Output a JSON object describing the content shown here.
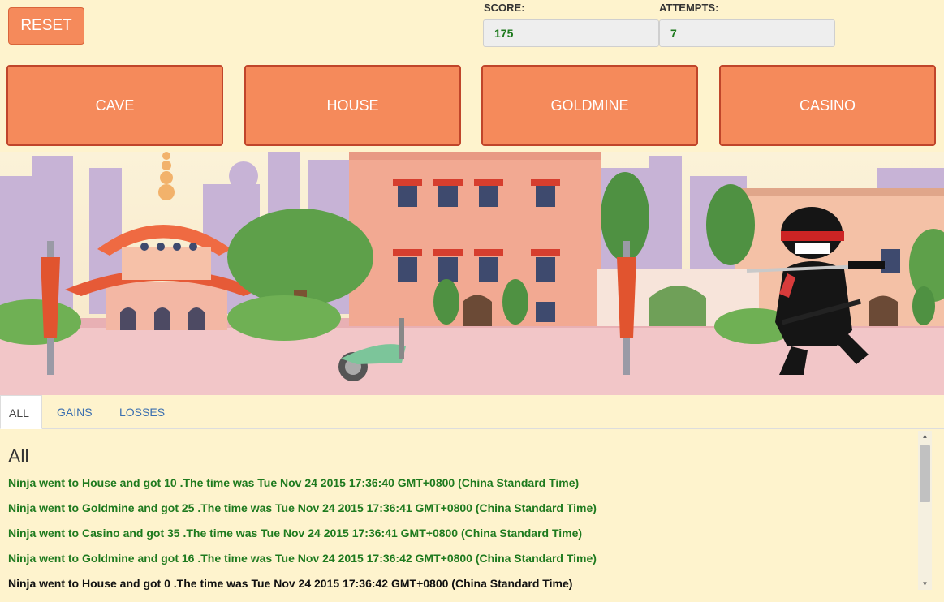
{
  "controls": {
    "reset_label": "RESET"
  },
  "stats": {
    "score_label": "SCORE:",
    "score_value": "175",
    "attempts_label": "ATTEMPTS:",
    "attempts_value": "7"
  },
  "locations": [
    "CAVE",
    "HOUSE",
    "GOLDMINE",
    "CASINO"
  ],
  "tabs": [
    "ALL",
    "GAINS",
    "LOSSES"
  ],
  "log": {
    "heading": "All",
    "entries": [
      {
        "text": "Ninja went to House and got 10 .The time was Tue Nov 24 2015 17:36:40 GMT+0800 (China Standard Time)",
        "color": "#1e7a1e"
      },
      {
        "text": "Ninja went to Goldmine and got 25 .The time was Tue Nov 24 2015 17:36:41 GMT+0800 (China Standard Time)",
        "color": "#1e7a1e"
      },
      {
        "text": "Ninja went to Casino and got 35 .The time was Tue Nov 24 2015 17:36:41 GMT+0800 (China Standard Time)",
        "color": "#1e7a1e"
      },
      {
        "text": "Ninja went to Goldmine and got 16 .The time was Tue Nov 24 2015 17:36:42 GMT+0800 (China Standard Time)",
        "color": "#1e7a1e"
      },
      {
        "text": "Ninja went to House and got 0 .The time was Tue Nov 24 2015 17:36:42 GMT+0800 (China Standard Time)",
        "color": "#111111"
      }
    ]
  },
  "colors": {
    "accent": "#f58a5b",
    "background": "#fef3cd",
    "gain_text": "#1e7a1e"
  }
}
